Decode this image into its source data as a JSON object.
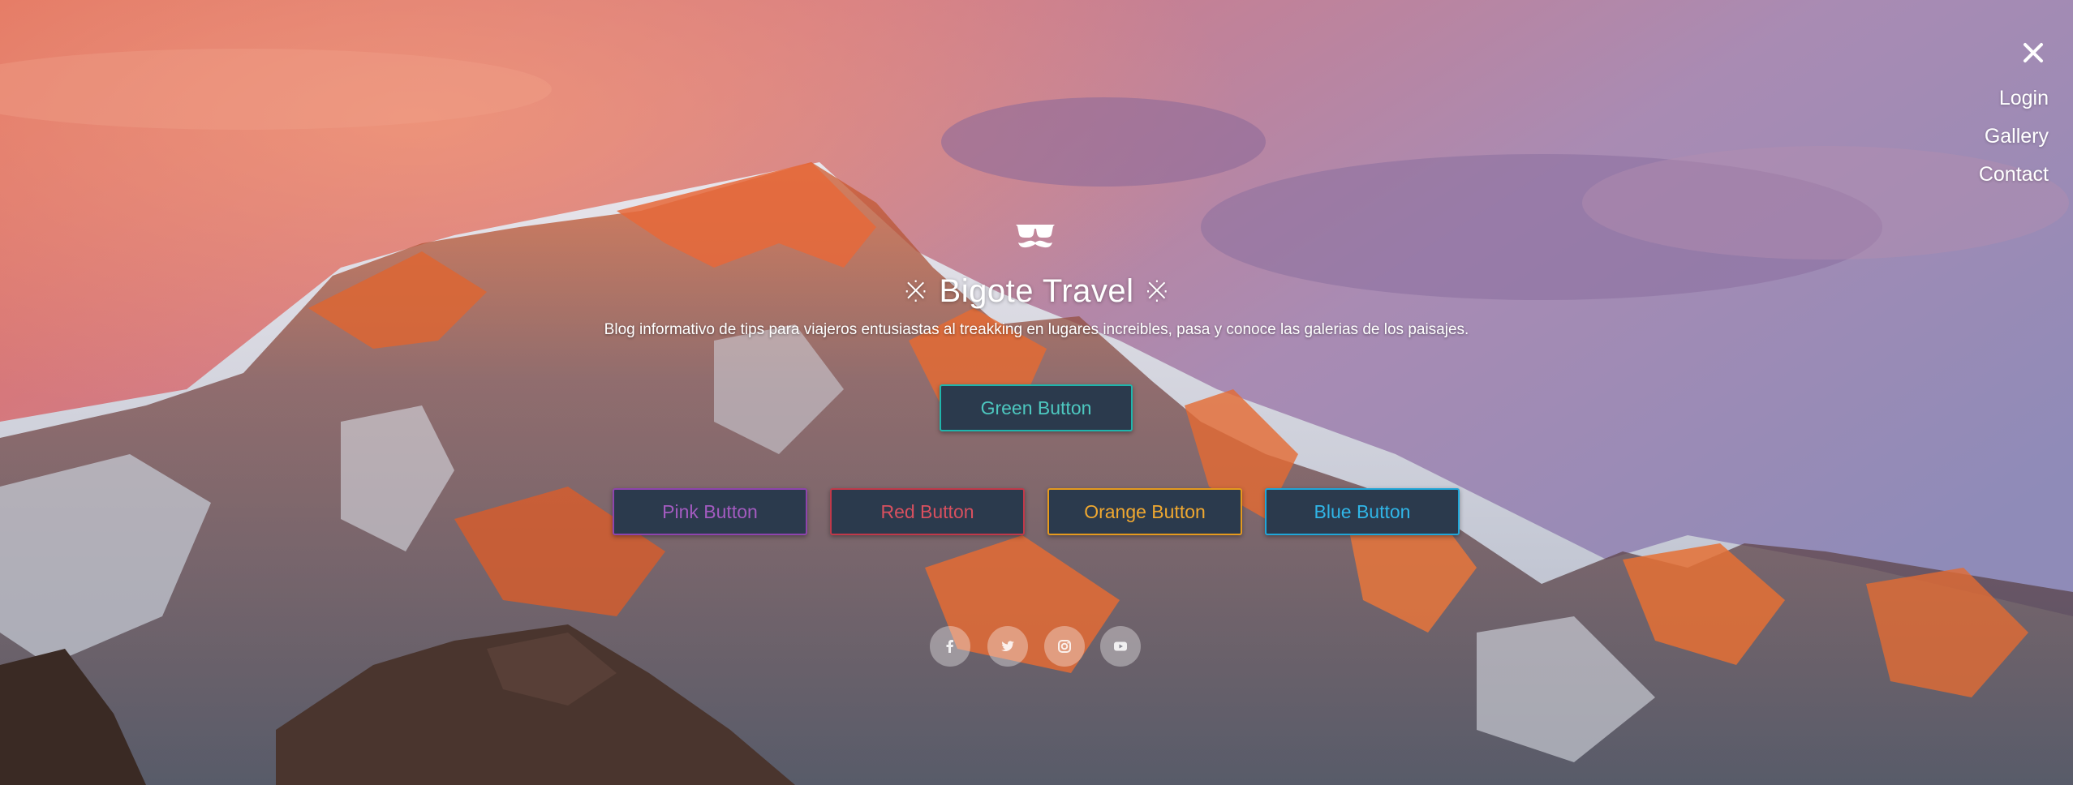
{
  "nav": {
    "items": [
      {
        "label": "Login"
      },
      {
        "label": "Gallery"
      },
      {
        "label": "Contact"
      }
    ]
  },
  "hero": {
    "logo_icon": "mustache-glasses-icon",
    "title": "※ Bigote Travel ※",
    "subtitle": "Blog informativo de tips para viajeros entusiastas al treakking en lugares increibles, pasa y conoce las galerias de los paisajes."
  },
  "buttons": {
    "green": "Green Button",
    "pink": "Pink Button",
    "red": "Red Button",
    "orange": "Orange Button",
    "blue": "Blue Button"
  },
  "colors": {
    "green": "#1fb5ac",
    "pink": "#8e44ad",
    "red": "#c0394a",
    "orange": "#e59a1e",
    "blue": "#20a6d8",
    "button_bg": "#2b3a4d"
  },
  "social": [
    "facebook-icon",
    "twitter-icon",
    "instagram-icon",
    "youtube-icon"
  ]
}
